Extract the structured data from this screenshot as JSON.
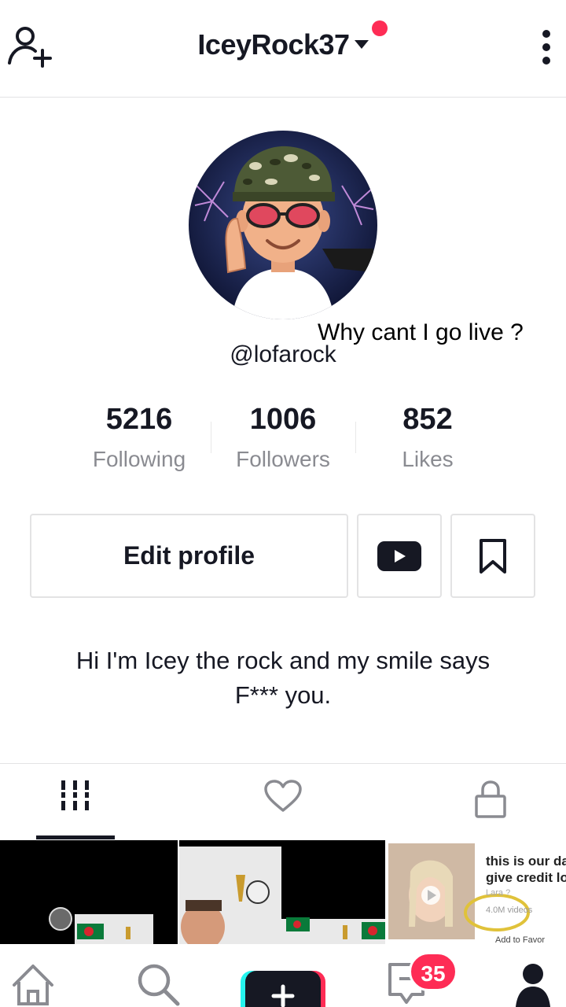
{
  "header": {
    "username": "IceyRock37"
  },
  "profile": {
    "handle": "@lofarock",
    "overlay_text": "Why cant I go live ?"
  },
  "stats": [
    {
      "value": "5216",
      "label": "Following"
    },
    {
      "value": "1006",
      "label": "Followers"
    },
    {
      "value": "852",
      "label": "Likes"
    }
  ],
  "actions": {
    "edit_profile": "Edit profile"
  },
  "bio": {
    "line1": "Hi I'm Icey the rock and my smile says",
    "line2": "F*** you."
  },
  "tabs": {
    "icons": [
      "grid-icon",
      "heart-icon",
      "lock-icon"
    ],
    "active": "grid-icon"
  },
  "videos": {
    "thumb3_text_line1": "this is our da",
    "thumb3_text_line2": "give credit lo"
  },
  "bottom_nav": {
    "inbox_badge": "35",
    "icons": [
      "home-icon",
      "search-icon",
      "create-icon",
      "inbox-icon",
      "profile-icon"
    ]
  },
  "colors": {
    "accent": "#fe2c55",
    "text": "#161823",
    "muted": "#8a8b91"
  }
}
